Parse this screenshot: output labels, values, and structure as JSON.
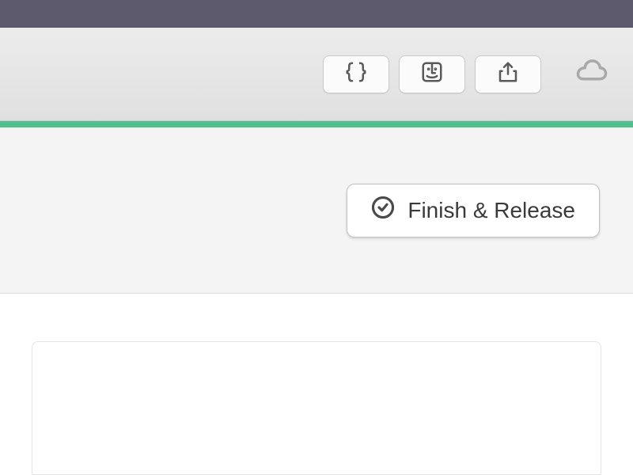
{
  "toolbar": {
    "code_button": "code",
    "finder_button": "finder",
    "share_button": "share",
    "cloud_status": "cloud"
  },
  "actions": {
    "finish_release_label": "Finish & Release"
  },
  "colors": {
    "titlebar": "#5d5a6e",
    "progress": "#4fc08d"
  }
}
